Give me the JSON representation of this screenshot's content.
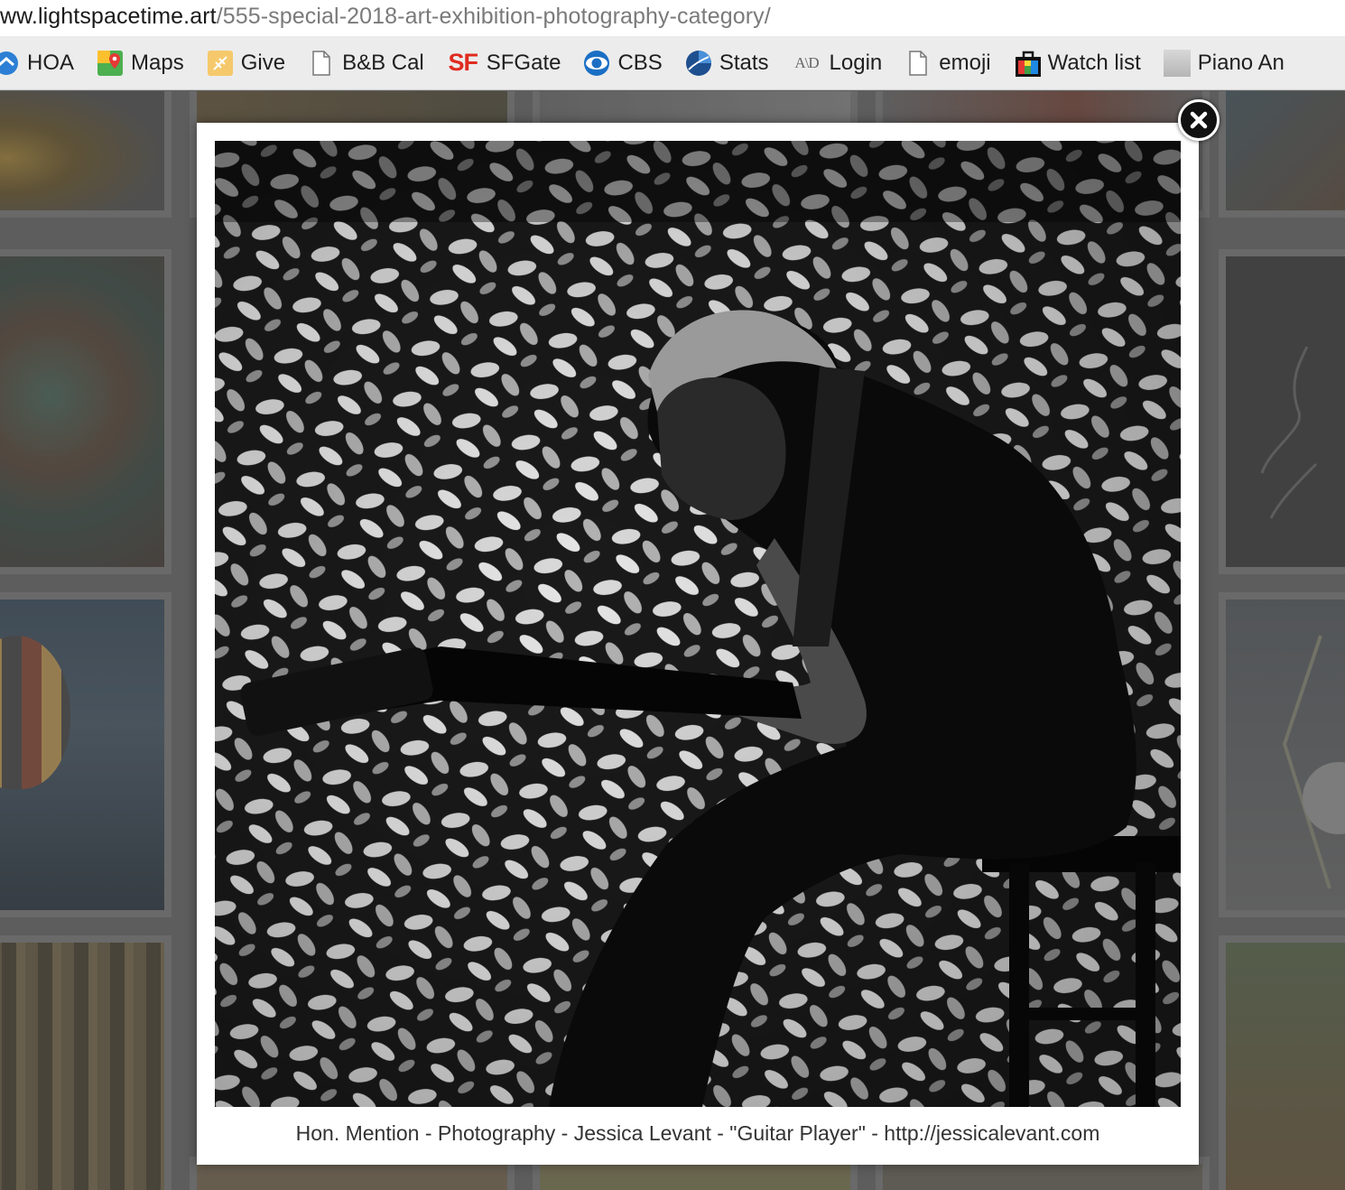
{
  "address_bar": {
    "url_host": "ww.lightspacetime.art",
    "url_path": "/555-special-2018-art-exhibition-photography-category/"
  },
  "bookmarks": [
    {
      "label": "HOA",
      "icon": "hoa-icon"
    },
    {
      "label": "Maps",
      "icon": "maps-icon"
    },
    {
      "label": "Give",
      "icon": "give-icon"
    },
    {
      "label": "B&B Cal",
      "icon": "page-icon"
    },
    {
      "label": "SFGate",
      "icon": "sf-icon"
    },
    {
      "label": "CBS",
      "icon": "cbs-eye-icon"
    },
    {
      "label": "Stats",
      "icon": "stats-icon"
    },
    {
      "label": "Login",
      "icon": "ad-icon"
    },
    {
      "label": "emoji",
      "icon": "page-icon"
    },
    {
      "label": "Watch list",
      "icon": "watchlist-icon"
    },
    {
      "label": "Piano An",
      "icon": "blank-favicon-icon"
    }
  ],
  "lightbox": {
    "caption": "Hon. Mention - Photography - Jessica Levant - \"Guitar Player\" - http://jessicalevant.com",
    "close_icon": "close-icon"
  },
  "colors": {
    "sf_red": "#e02b20",
    "cbs_blue": "#1a6fc4",
    "overlay": "#5f5f5f"
  }
}
